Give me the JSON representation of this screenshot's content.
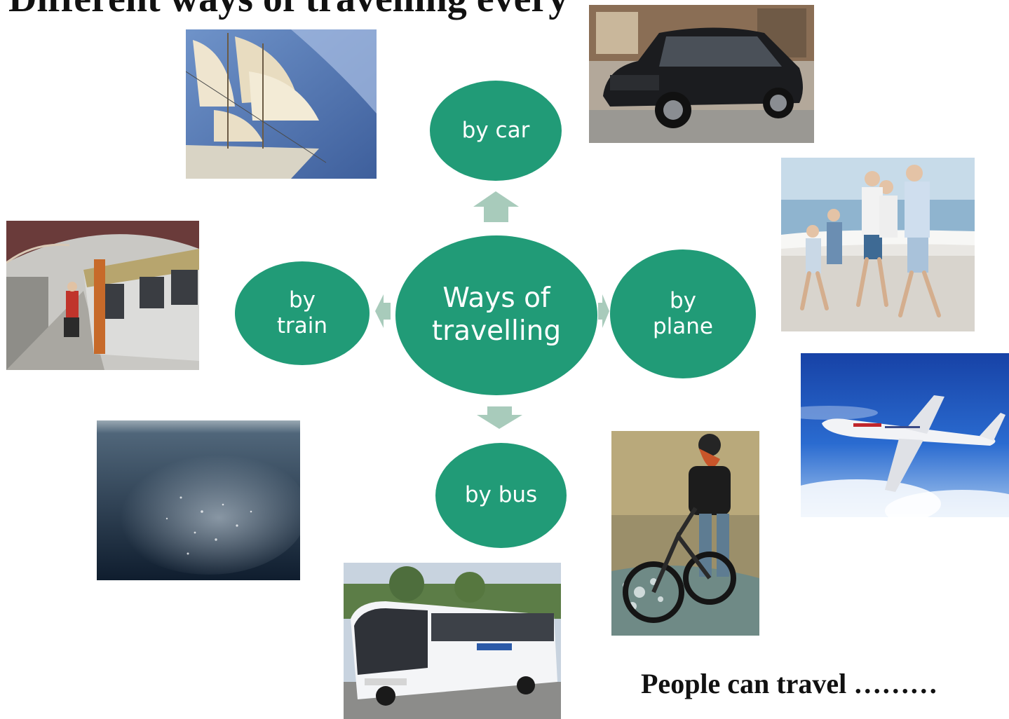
{
  "slide": {
    "title": "Different ways of travelling every",
    "center": "Ways of travelling",
    "nodes": {
      "top": "by car",
      "left": "by train",
      "right": "by plane",
      "bottom": "by bus"
    },
    "caption": "People can travel ………"
  },
  "colors": {
    "node_fill": "#219B77",
    "arrow_fill": "#A8CBBB",
    "node_text": "#FFFFFF"
  },
  "images": [
    {
      "name": "sailing-ship-photo",
      "subject": "sailing ship"
    },
    {
      "name": "car-photo",
      "subject": "car"
    },
    {
      "name": "family-running-photo",
      "subject": "family running on beach"
    },
    {
      "name": "train-station-photo",
      "subject": "train at station"
    },
    {
      "name": "sea-photo",
      "subject": "sea water"
    },
    {
      "name": "cyclist-photo",
      "subject": "cyclist"
    },
    {
      "name": "airplane-photo",
      "subject": "airplane"
    },
    {
      "name": "bus-photo",
      "subject": "bus"
    }
  ]
}
